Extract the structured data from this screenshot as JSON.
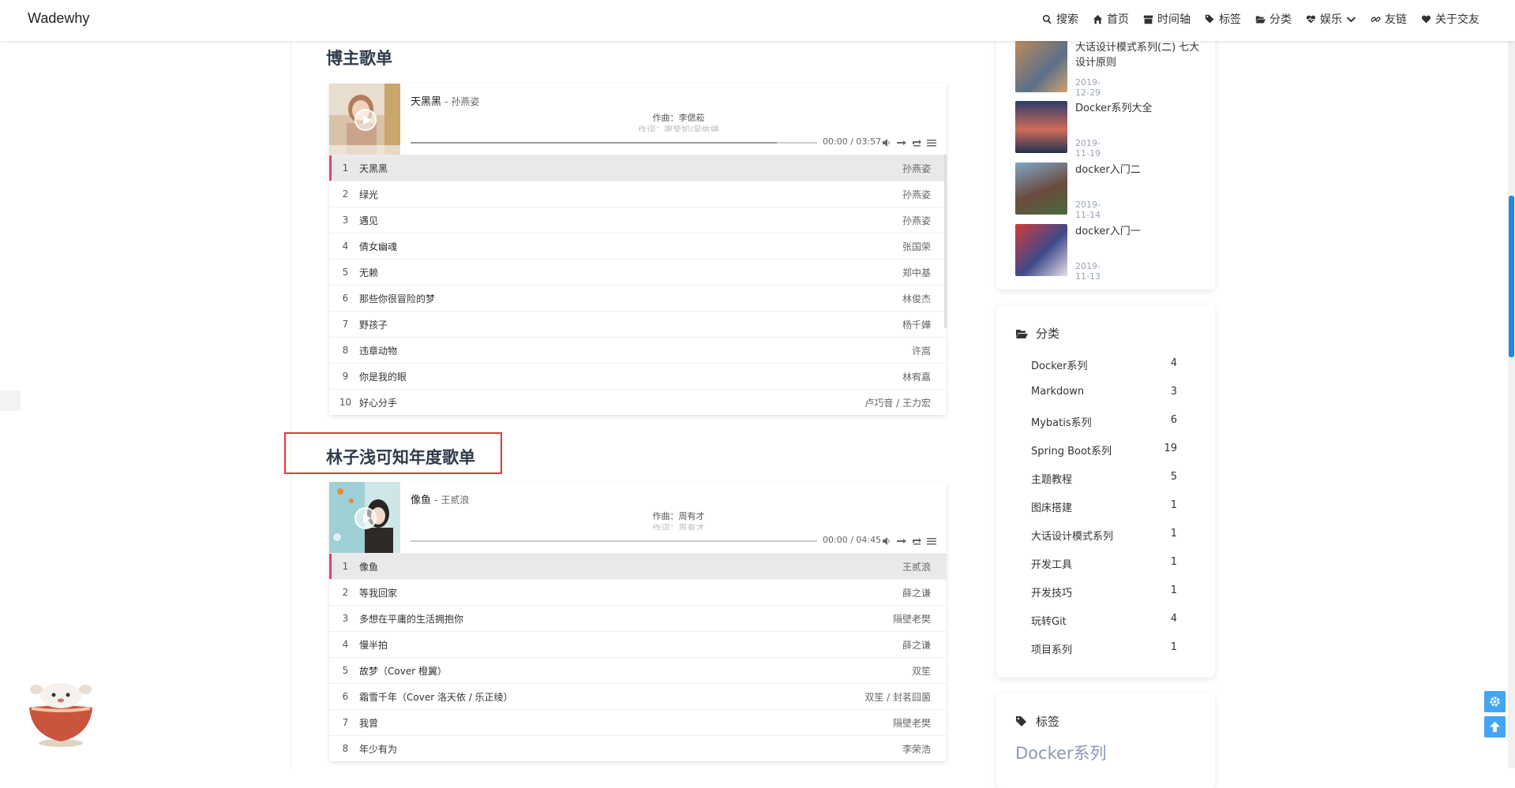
{
  "header": {
    "brand": "Wadewhy",
    "nav": [
      {
        "label": "搜索",
        "icon": "search-icon"
      },
      {
        "label": "首页",
        "icon": "home-icon"
      },
      {
        "label": "时间轴",
        "icon": "archive-icon"
      },
      {
        "label": "标签",
        "icon": "tags-icon"
      },
      {
        "label": "分类",
        "icon": "folder-open-icon"
      },
      {
        "label": "娱乐",
        "icon": "heartbeat-icon"
      },
      {
        "label": "友链",
        "icon": "link-icon"
      },
      {
        "label": "关于交友",
        "icon": "heart-icon"
      }
    ]
  },
  "sections": [
    {
      "title": "博主歌单",
      "player": {
        "song": "天黑黑",
        "artist": "孙燕姿",
        "lyric1": "作曲：李偲菘",
        "lyric2": "作词：廖莹如/吴依婷",
        "time": "00:00 / 03:57",
        "progress": 0.9,
        "tracks": [
          {
            "num": "1",
            "title": "天黑黑",
            "artist": "孙燕姿"
          },
          {
            "num": "2",
            "title": "绿光",
            "artist": "孙燕姿"
          },
          {
            "num": "3",
            "title": "遇见",
            "artist": "孙燕姿"
          },
          {
            "num": "4",
            "title": "倩女幽魂",
            "artist": "张国荣"
          },
          {
            "num": "5",
            "title": "无赖",
            "artist": "郑中基"
          },
          {
            "num": "6",
            "title": "那些你很冒险的梦",
            "artist": "林俊杰"
          },
          {
            "num": "7",
            "title": "野孩子",
            "artist": "杨千嬅"
          },
          {
            "num": "8",
            "title": "违章动物",
            "artist": "许嵩"
          },
          {
            "num": "9",
            "title": "你是我的眼",
            "artist": "林宥嘉"
          },
          {
            "num": "10",
            "title": "好心分手",
            "artist": "卢巧音 / 王力宏"
          }
        ]
      }
    },
    {
      "title": "林子浅可知年度歌单",
      "player": {
        "song": "像鱼",
        "artist": "王贰浪",
        "lyric1": "作曲：周有才",
        "lyric2": "作词：周有才",
        "time": "00:00 / 04:45",
        "progress": 0.0,
        "tracks": [
          {
            "num": "1",
            "title": "像鱼",
            "artist": "王贰浪"
          },
          {
            "num": "2",
            "title": "等我回家",
            "artist": "薛之谦"
          },
          {
            "num": "3",
            "title": "多想在平庸的生活拥抱你",
            "artist": "隔壁老樊"
          },
          {
            "num": "4",
            "title": "慢半拍",
            "artist": "薛之谦"
          },
          {
            "num": "5",
            "title": "故梦（Cover 橙翼）",
            "artist": "双笙"
          },
          {
            "num": "6",
            "title": "霜雪千年（Cover 洛天依 / 乐正绫）",
            "artist": "双笙 / 封茗囧菌"
          },
          {
            "num": "7",
            "title": "我曾",
            "artist": "隔壁老樊"
          },
          {
            "num": "8",
            "title": "年少有为",
            "artist": "李荣浩"
          }
        ]
      }
    }
  ],
  "sidebar": {
    "recent_posts": [
      {
        "title": "大话设计模式系列(二) 七大设计原则",
        "date": "2019-12-29"
      },
      {
        "title": "Docker系列大全",
        "date": "2019-11-19"
      },
      {
        "title": "docker入门二",
        "date": "2019-11-14"
      },
      {
        "title": "docker入门一",
        "date": "2019-11-13"
      }
    ],
    "categories_title": "分类",
    "categories": [
      {
        "name": "Docker系列",
        "count": "4"
      },
      {
        "name": "Markdown",
        "count": "3"
      },
      {
        "name": "Mybatis系列",
        "count": "6"
      },
      {
        "name": "Spring Boot系列",
        "count": "19"
      },
      {
        "name": "主题教程",
        "count": "5"
      },
      {
        "name": "图床搭建",
        "count": "1"
      },
      {
        "name": "大话设计模式系列",
        "count": "1"
      },
      {
        "name": "开发工具",
        "count": "1"
      },
      {
        "name": "开发技巧",
        "count": "1"
      },
      {
        "name": "玩转Git",
        "count": "4"
      },
      {
        "name": "项目系列",
        "count": "1"
      }
    ],
    "tags_title": "标签",
    "tag_first": "Docker系列"
  },
  "colors": {
    "accent": "#e2426c",
    "highlight": "#e53935",
    "fab": "#42a5f5",
    "title": "#2f3b4c"
  }
}
